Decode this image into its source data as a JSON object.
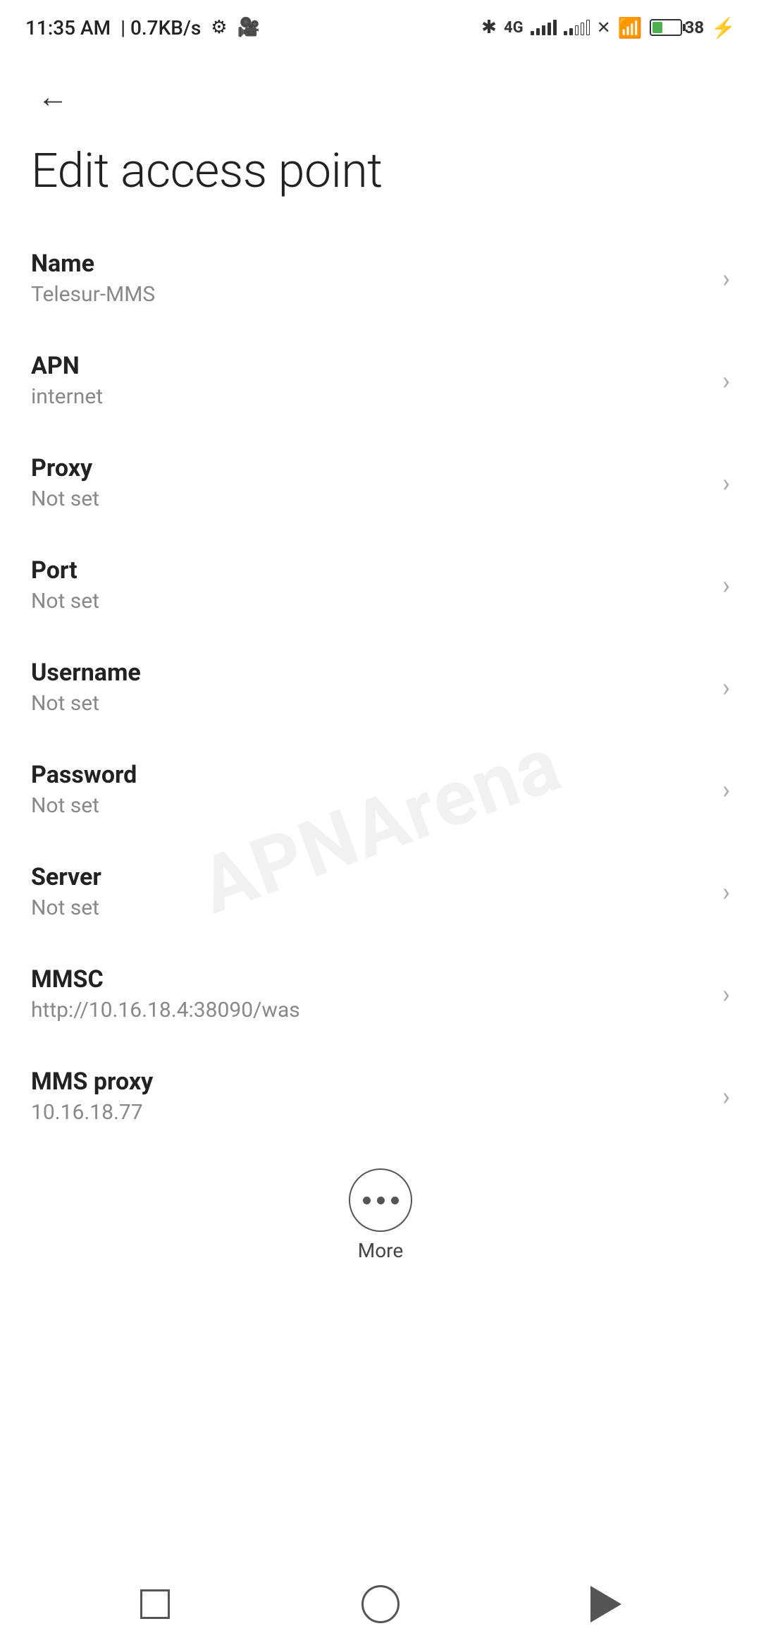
{
  "statusBar": {
    "time": "11:35 AM",
    "speed": "0.7KB/s",
    "battery": "38"
  },
  "header": {
    "backLabel": "←",
    "title": "Edit access point"
  },
  "settings": {
    "items": [
      {
        "label": "Name",
        "value": "Telesur-MMS"
      },
      {
        "label": "APN",
        "value": "internet"
      },
      {
        "label": "Proxy",
        "value": "Not set"
      },
      {
        "label": "Port",
        "value": "Not set"
      },
      {
        "label": "Username",
        "value": "Not set"
      },
      {
        "label": "Password",
        "value": "Not set"
      },
      {
        "label": "Server",
        "value": "Not set"
      },
      {
        "label": "MMSC",
        "value": "http://10.16.18.4:38090/was"
      },
      {
        "label": "MMS proxy",
        "value": "10.16.18.77"
      }
    ]
  },
  "more": {
    "label": "More"
  },
  "watermark": "APNArena",
  "navigation": {
    "square": "recent-apps",
    "circle": "home",
    "back": "back"
  }
}
